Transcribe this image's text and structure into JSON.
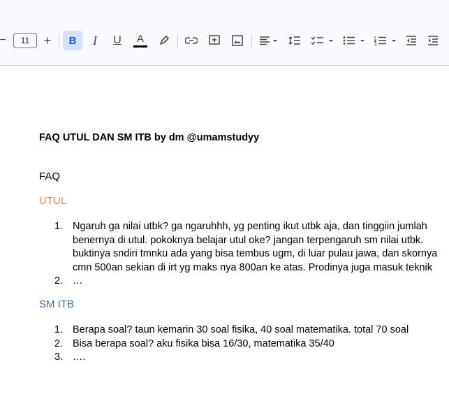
{
  "toolbar": {
    "minus": "−",
    "font_size": "11",
    "plus": "+",
    "bold": "B",
    "italic": "I",
    "underline": "U",
    "text_color": "A"
  },
  "colors": {
    "utul": "#e69138",
    "sm_itb": "#3d6ea8",
    "bold_active_bg": "#d3e3fd",
    "text_color_bar": "#000000"
  },
  "doc": {
    "title": "FAQ UTUL DAN SM ITB by dm @umamstudyy",
    "faq_heading": "FAQ",
    "utul_heading": "UTUL",
    "utul_items": [
      {
        "num": "1.",
        "lines": [
          "Ngaruh ga nilai utbk? ga ngaruhhh, yg penting ikut utbk aja, dan tinggiin jumlah",
          "benernya di utul. pokoknya belajar utul oke? jangan terpengaruh sm nilai utbk.",
          "buktinya sndiri tmnku ada yang bisa tembus ugm, di luar pulau jawa, dan skornya",
          "cmn 500an sekian di irt yg maks nya 800an ke atas. Prodinya juga masuk teknik"
        ]
      },
      {
        "num": "2.",
        "lines": [
          "…"
        ]
      }
    ],
    "sm_heading": "SM ITB",
    "sm_items": [
      {
        "num": "1.",
        "lines": [
          "Berapa soal? taun kemarin 30 soal fisika, 40 soal matematika. total 70 soal"
        ]
      },
      {
        "num": "2.",
        "lines": [
          "Bisa berapa soal? aku fisika bisa 16/30, matematika 35/40"
        ]
      },
      {
        "num": "3.",
        "lines": [
          "…."
        ]
      }
    ]
  }
}
